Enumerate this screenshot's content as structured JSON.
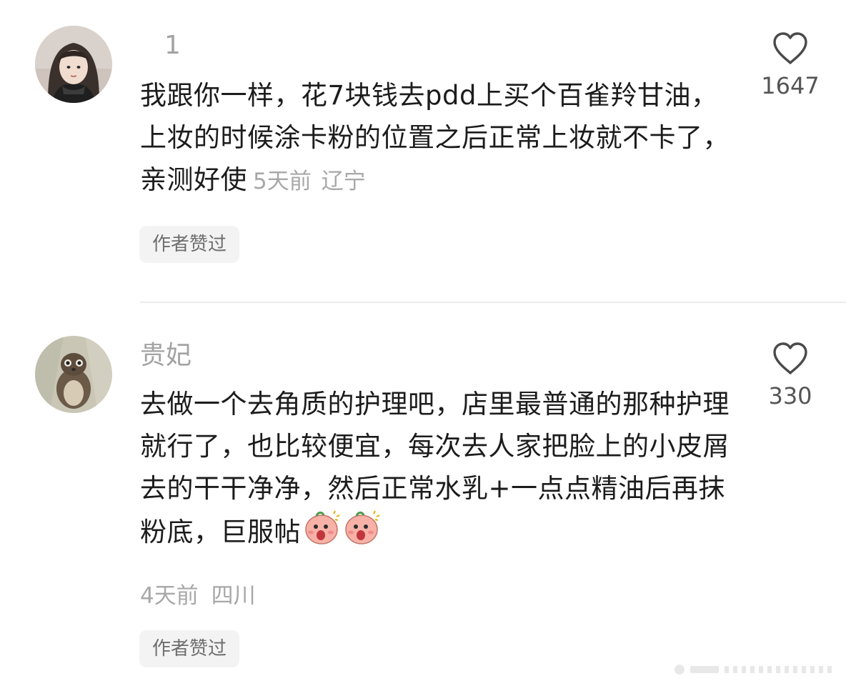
{
  "comments": [
    {
      "username": "1",
      "avatar_icon": "user-avatar-girl",
      "body": "我跟你一样，花7块钱去pdd上买个百雀羚甘油，上妆的时候涂卡粉的位置之后正常上妆就不卡了，亲测好使",
      "time": "5天前",
      "location": "辽宁",
      "like_icon": "heart-outline-icon",
      "likes": "1647",
      "badge": "作者赞过"
    },
    {
      "username": "贵妃",
      "avatar_icon": "user-avatar-otter",
      "body": "去做一个去角质的护理吧，店里最普通的那种护理就行了，也比较便宜，每次去人家把脸上的小皮屑去的干干净净，然后正常水乳+一点点精油后再抹粉底，巨服帖",
      "emoji": [
        "shocked-face-emoji",
        "shocked-face-emoji"
      ],
      "time": "4天前",
      "location": "四川",
      "like_icon": "heart-outline-icon",
      "likes": "330",
      "badge": "作者赞过"
    }
  ],
  "colors": {
    "meta_gray": "#a8a8a8",
    "badge_bg": "#f3f3f3",
    "text": "#1c1c1c"
  }
}
